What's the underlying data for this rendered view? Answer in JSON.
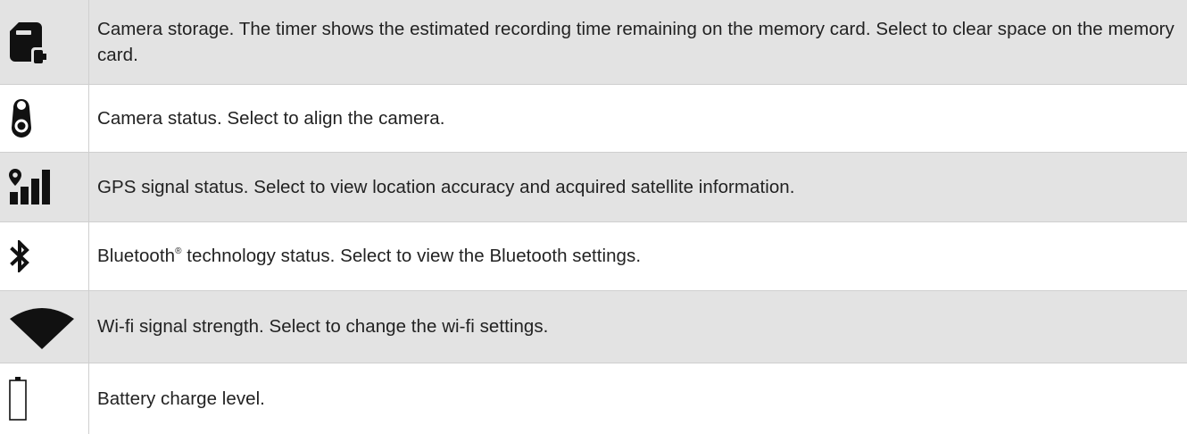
{
  "rows": [
    {
      "icon": "camera-storage-icon",
      "description": "Camera storage. The timer shows the estimated recording time remaining on the memory card. Select to clear space on the memory card."
    },
    {
      "icon": "camera-status-icon",
      "description": "Camera status. Select to align the camera."
    },
    {
      "icon": "gps-signal-icon",
      "description": "GPS signal status. Select to view location accuracy and acquired satellite information."
    },
    {
      "icon": "bluetooth-icon",
      "description_before": "Bluetooth",
      "registered_mark": "®",
      "description_after": " technology status. Select to view the Bluetooth settings."
    },
    {
      "icon": "wifi-signal-icon",
      "description": "Wi-fi signal strength. Select to change the wi-fi settings."
    },
    {
      "icon": "battery-icon",
      "description": "Battery charge level."
    }
  ],
  "colors": {
    "shaded_row": "#e3e3e3",
    "border": "#cfcfcf",
    "icon": "#111111"
  }
}
